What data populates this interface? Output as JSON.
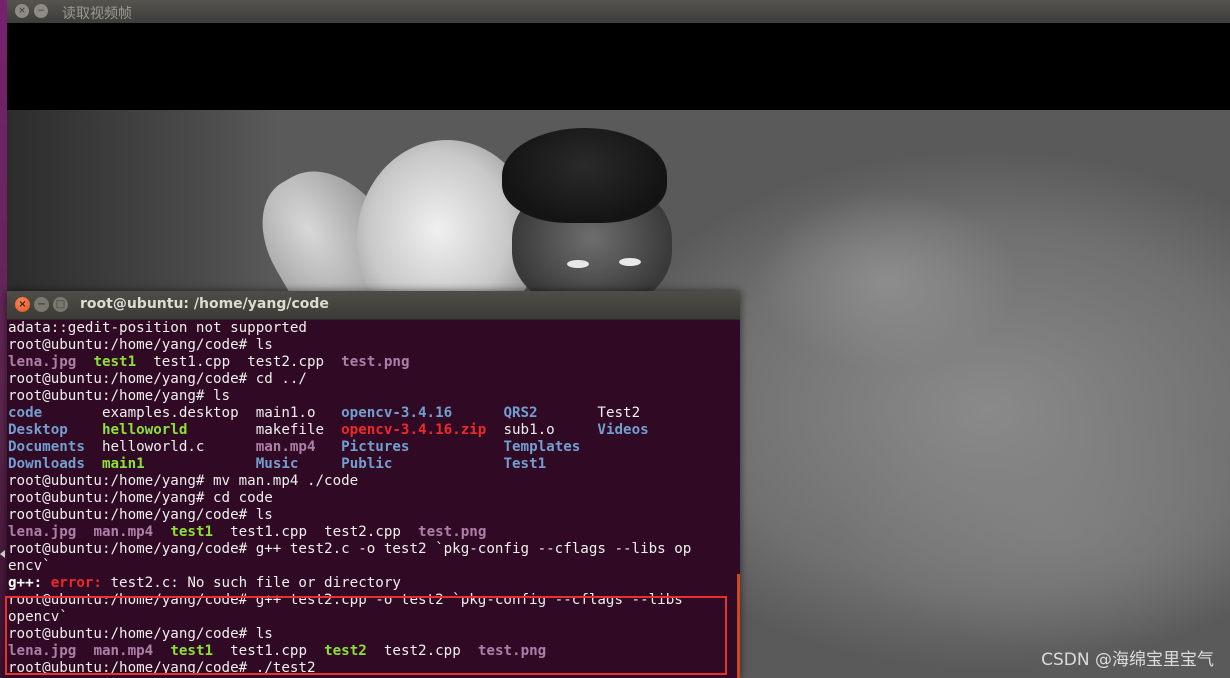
{
  "video_window": {
    "title": "读取视频帧",
    "close_glyph": "×",
    "min_glyph": "−"
  },
  "terminal": {
    "title": "root@ubuntu: /home/yang/code",
    "close_glyph": "×",
    "min_glyph": "−",
    "max_glyph": "□",
    "lines": [
      [
        {
          "t": "adata::gedit-position not supported",
          "c": "plain"
        }
      ],
      [
        {
          "t": "root@ubuntu:/home/yang/code# ls",
          "c": "plain"
        }
      ],
      [
        {
          "t": "lena.jpg",
          "c": "purple"
        },
        {
          "t": "  ",
          "c": "plain"
        },
        {
          "t": "test1",
          "c": "green"
        },
        {
          "t": "  test1.cpp  test2.cpp  ",
          "c": "plain"
        },
        {
          "t": "test.png",
          "c": "purple"
        }
      ],
      [
        {
          "t": "root@ubuntu:/home/yang/code# cd ../",
          "c": "plain"
        }
      ],
      [
        {
          "t": "root@ubuntu:/home/yang# ls",
          "c": "plain"
        }
      ],
      [
        {
          "t": "code",
          "c": "blue"
        },
        {
          "t": "       examples.desktop  main1.o   ",
          "c": "plain"
        },
        {
          "t": "opencv-3.4.16",
          "c": "blue"
        },
        {
          "t": "      ",
          "c": "plain"
        },
        {
          "t": "QRS2",
          "c": "blue"
        },
        {
          "t": "       Test2",
          "c": "plain"
        }
      ],
      [
        {
          "t": "Desktop",
          "c": "blue"
        },
        {
          "t": "    ",
          "c": "plain"
        },
        {
          "t": "helloworld",
          "c": "green"
        },
        {
          "t": "        makefile  ",
          "c": "plain"
        },
        {
          "t": "opencv-3.4.16.zip",
          "c": "red"
        },
        {
          "t": "  sub1.o     ",
          "c": "plain"
        },
        {
          "t": "Videos",
          "c": "blue"
        }
      ],
      [
        {
          "t": "Documents",
          "c": "blue"
        },
        {
          "t": "  helloworld.c      ",
          "c": "plain"
        },
        {
          "t": "man.mp4",
          "c": "purple"
        },
        {
          "t": "   ",
          "c": "plain"
        },
        {
          "t": "Pictures",
          "c": "blue"
        },
        {
          "t": "           ",
          "c": "plain"
        },
        {
          "t": "Templates",
          "c": "blue"
        }
      ],
      [
        {
          "t": "Downloads",
          "c": "blue"
        },
        {
          "t": "  ",
          "c": "plain"
        },
        {
          "t": "main1",
          "c": "green"
        },
        {
          "t": "             ",
          "c": "plain"
        },
        {
          "t": "Music",
          "c": "blue"
        },
        {
          "t": "     ",
          "c": "plain"
        },
        {
          "t": "Public",
          "c": "blue"
        },
        {
          "t": "             ",
          "c": "plain"
        },
        {
          "t": "Test1",
          "c": "blue"
        }
      ],
      [
        {
          "t": "root@ubuntu:/home/yang# mv man.mp4 ./code",
          "c": "plain"
        }
      ],
      [
        {
          "t": "root@ubuntu:/home/yang# cd code",
          "c": "plain"
        }
      ],
      [
        {
          "t": "root@ubuntu:/home/yang/code# ls",
          "c": "plain"
        }
      ],
      [
        {
          "t": "lena.jpg",
          "c": "purple"
        },
        {
          "t": "  ",
          "c": "plain"
        },
        {
          "t": "man.mp4",
          "c": "purple"
        },
        {
          "t": "  ",
          "c": "plain"
        },
        {
          "t": "test1",
          "c": "green"
        },
        {
          "t": "  test1.cpp  test2.cpp  ",
          "c": "plain"
        },
        {
          "t": "test.png",
          "c": "purple"
        }
      ],
      [
        {
          "t": "root@ubuntu:/home/yang/code# g++ test2.c -o test2 `pkg-config --cflags --libs op",
          "c": "plain"
        }
      ],
      [
        {
          "t": "encv`",
          "c": "plain"
        }
      ],
      [
        {
          "t": "g++: ",
          "c": "bold"
        },
        {
          "t": "error: ",
          "c": "red"
        },
        {
          "t": "test2.c: No such file or directory",
          "c": "plain"
        }
      ],
      [
        {
          "t": "root@ubuntu:/home/yang/code# g++ test2.cpp -o test2 `pkg-config --cflags --libs",
          "c": "plain"
        }
      ],
      [
        {
          "t": "opencv`",
          "c": "plain"
        }
      ],
      [
        {
          "t": "root@ubuntu:/home/yang/code# ls",
          "c": "plain"
        }
      ],
      [
        {
          "t": "lena.jpg",
          "c": "purple"
        },
        {
          "t": "  ",
          "c": "plain"
        },
        {
          "t": "man.mp4",
          "c": "purple"
        },
        {
          "t": "  ",
          "c": "plain"
        },
        {
          "t": "test1",
          "c": "green"
        },
        {
          "t": "  test1.cpp  ",
          "c": "plain"
        },
        {
          "t": "test2",
          "c": "green"
        },
        {
          "t": "  test2.cpp  ",
          "c": "plain"
        },
        {
          "t": "test.png",
          "c": "purple"
        }
      ],
      [
        {
          "t": "root@ubuntu:/home/yang/code# ./test2",
          "c": "plain"
        }
      ]
    ]
  },
  "watermark": "CSDN @海绵宝里宝气",
  "colors": {
    "terminal_bg": "#300a24",
    "highlight_border": "#e8302f",
    "ls_directory": "#729fcf",
    "ls_executable": "#8ae234",
    "ls_media": "#ad7fa8",
    "ls_archive": "#ef2929"
  }
}
